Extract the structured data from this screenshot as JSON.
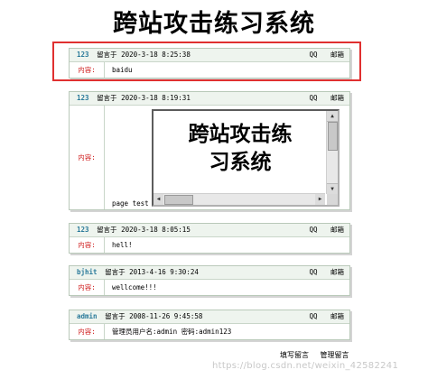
{
  "page_title": "跨站攻击练习系统",
  "content_label": "内容:",
  "qq_label": "QQ",
  "mail_label": "邮箱",
  "messages": [
    {
      "author": "123",
      "posted_label": "留言于",
      "timestamp": "2020-3-18 8:25:38",
      "content": "baidu"
    },
    {
      "author": "123",
      "posted_label": "留言于",
      "timestamp": "2020-3-18 8:19:31",
      "embed_text_line1": "跨站攻击练",
      "embed_text_line2": "习系统",
      "content": "page test"
    },
    {
      "author": "123",
      "posted_label": "留言于",
      "timestamp": "2020-3-18 8:05:15",
      "content": "hell!"
    },
    {
      "author": "bjhit",
      "posted_label": "留言于",
      "timestamp": "2013-4-16 9:30:24",
      "content": "wellcome!!!"
    },
    {
      "author": "admin",
      "posted_label": "留言于",
      "timestamp": "2008-11-26 9:45:58",
      "content": "管理员用户名:admin 密码:admin123"
    }
  ],
  "footer": {
    "write_label": "填写留言",
    "manage_label": "管理留言"
  },
  "watermark": "https://blog.csdn.net/weixin_42582241"
}
